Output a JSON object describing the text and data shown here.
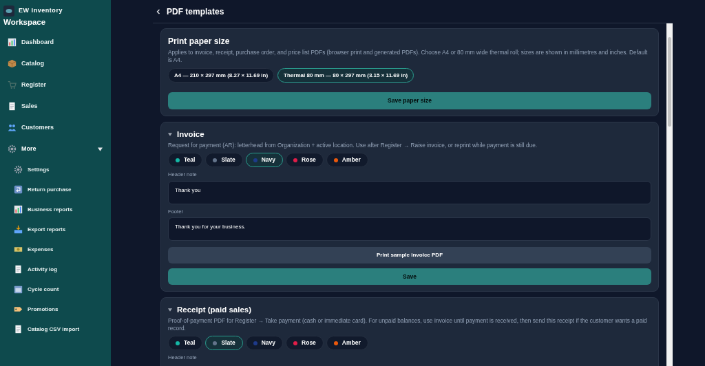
{
  "sidebar": {
    "brand": "EW Inventory",
    "workspace": "Workspace",
    "items": [
      {
        "label": "Dashboard"
      },
      {
        "label": "Catalog"
      },
      {
        "label": "Register"
      },
      {
        "label": "Sales"
      },
      {
        "label": "Customers"
      }
    ],
    "more": {
      "label": "More",
      "expanded": true,
      "children": [
        {
          "label": "Settings"
        },
        {
          "label": "Return purchase"
        },
        {
          "label": "Business reports"
        },
        {
          "label": "Export reports"
        },
        {
          "label": "Expenses"
        },
        {
          "label": "Activity log"
        },
        {
          "label": "Cycle count"
        },
        {
          "label": "Promotions"
        },
        {
          "label": "Catalog CSV import"
        }
      ]
    }
  },
  "header": {
    "title": "PDF templates"
  },
  "paper": {
    "title": "Print paper size",
    "description": "Applies to invoice, receipt, purchase order, and price list PDFs (browser print and generated PDFs). Choose A4 or 80 mm wide thermal roll; sizes are shown in millimetres and inches. Default is A4.",
    "options": [
      {
        "label": "A4 — 210 × 297 mm (8.27 × 11.69 in)",
        "selected": false
      },
      {
        "label": "Thermal 80 mm — 80 × 297 mm (3.15 × 11.69 in)",
        "selected": true
      }
    ],
    "save_button": "Save paper size"
  },
  "templates": [
    {
      "title": "Invoice",
      "expanded": true,
      "description": "Request for payment (AR): letterhead from Organization + active location. Use after Register → Raise invoice, or reprint while payment is still due.",
      "colors": [
        {
          "label": "Teal",
          "color": "#14b8a6",
          "selected": false
        },
        {
          "label": "Slate",
          "color": "#64748b",
          "selected": false
        },
        {
          "label": "Navy",
          "color": "#1e3a8a",
          "selected": true
        },
        {
          "label": "Rose",
          "color": "#e11d48",
          "selected": false
        },
        {
          "label": "Amber",
          "color": "#ea580c",
          "selected": false
        }
      ],
      "fields": [
        {
          "label": "Header note",
          "value": "Thank you"
        },
        {
          "label": "Footer",
          "value": "Thank you for your business."
        }
      ],
      "buttons": [
        {
          "label": "Print sample invoice PDF",
          "kind": "secondary"
        },
        {
          "label": "Save",
          "kind": "primary"
        }
      ]
    },
    {
      "title": "Receipt (paid sales)",
      "expanded": true,
      "description": "Proof-of-payment PDF for Register → Take payment (cash or immediate card). For unpaid balances, use Invoice until payment is received, then send this receipt if the customer wants a paid record.",
      "colors": [
        {
          "label": "Teal",
          "color": "#14b8a6",
          "selected": false
        },
        {
          "label": "Slate",
          "color": "#64748b",
          "selected": true
        },
        {
          "label": "Navy",
          "color": "#1e3a8a",
          "selected": false
        },
        {
          "label": "Rose",
          "color": "#e11d48",
          "selected": false
        },
        {
          "label": "Amber",
          "color": "#ea580c",
          "selected": false
        }
      ],
      "fields": [
        {
          "label": "Header note"
        }
      ]
    }
  ]
}
